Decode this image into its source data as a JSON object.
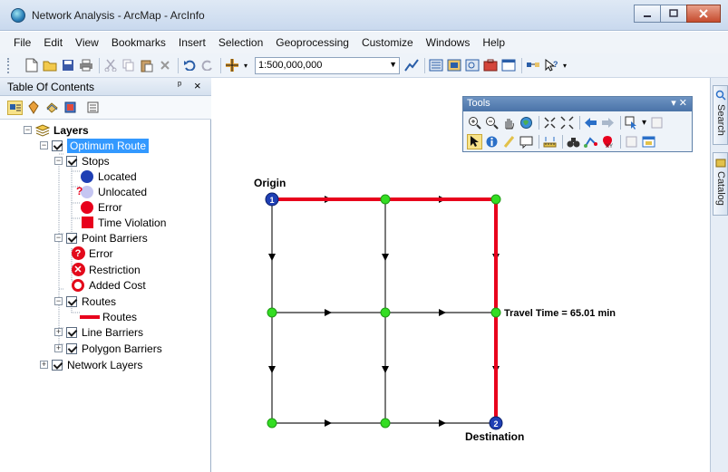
{
  "window": {
    "title": "Network Analysis - ArcMap - ArcInfo"
  },
  "menu": [
    "File",
    "Edit",
    "View",
    "Bookmarks",
    "Insert",
    "Selection",
    "Geoprocessing",
    "Customize",
    "Windows",
    "Help"
  ],
  "toolbar": {
    "scale": "1:500,000,000"
  },
  "toc": {
    "title": "Table Of Contents",
    "pin": "ᵖ",
    "close": "×",
    "layers_label": "Layers",
    "optimum_route": "Optimum Route",
    "stops": {
      "label": "Stops",
      "items": [
        "Located",
        "Unlocated",
        "Error",
        "Time Violation"
      ],
      "unlocated_mark": "?"
    },
    "point_barriers": {
      "label": "Point Barriers",
      "items": [
        "Error",
        "Restriction",
        "Added Cost"
      ],
      "error_glyph": "?",
      "restriction_glyph": "✕"
    },
    "routes": {
      "label": "Routes",
      "items": [
        "Routes"
      ]
    },
    "line_barriers": "Line Barriers",
    "polygon_barriers": "Polygon Barriers",
    "network_layers": "Network Layers"
  },
  "tools": {
    "title": "Tools"
  },
  "side_tabs": [
    "Search",
    "Catalog"
  ],
  "map": {
    "origin_label": "Origin",
    "destination_label": "Destination",
    "travel_time": "Travel Time = 65.01 min",
    "origin_stop_number": "1",
    "destination_stop_number": "2",
    "route_color": "#e8001c",
    "node_color": "#33dd22",
    "stop_color": "#1f3fb4"
  }
}
